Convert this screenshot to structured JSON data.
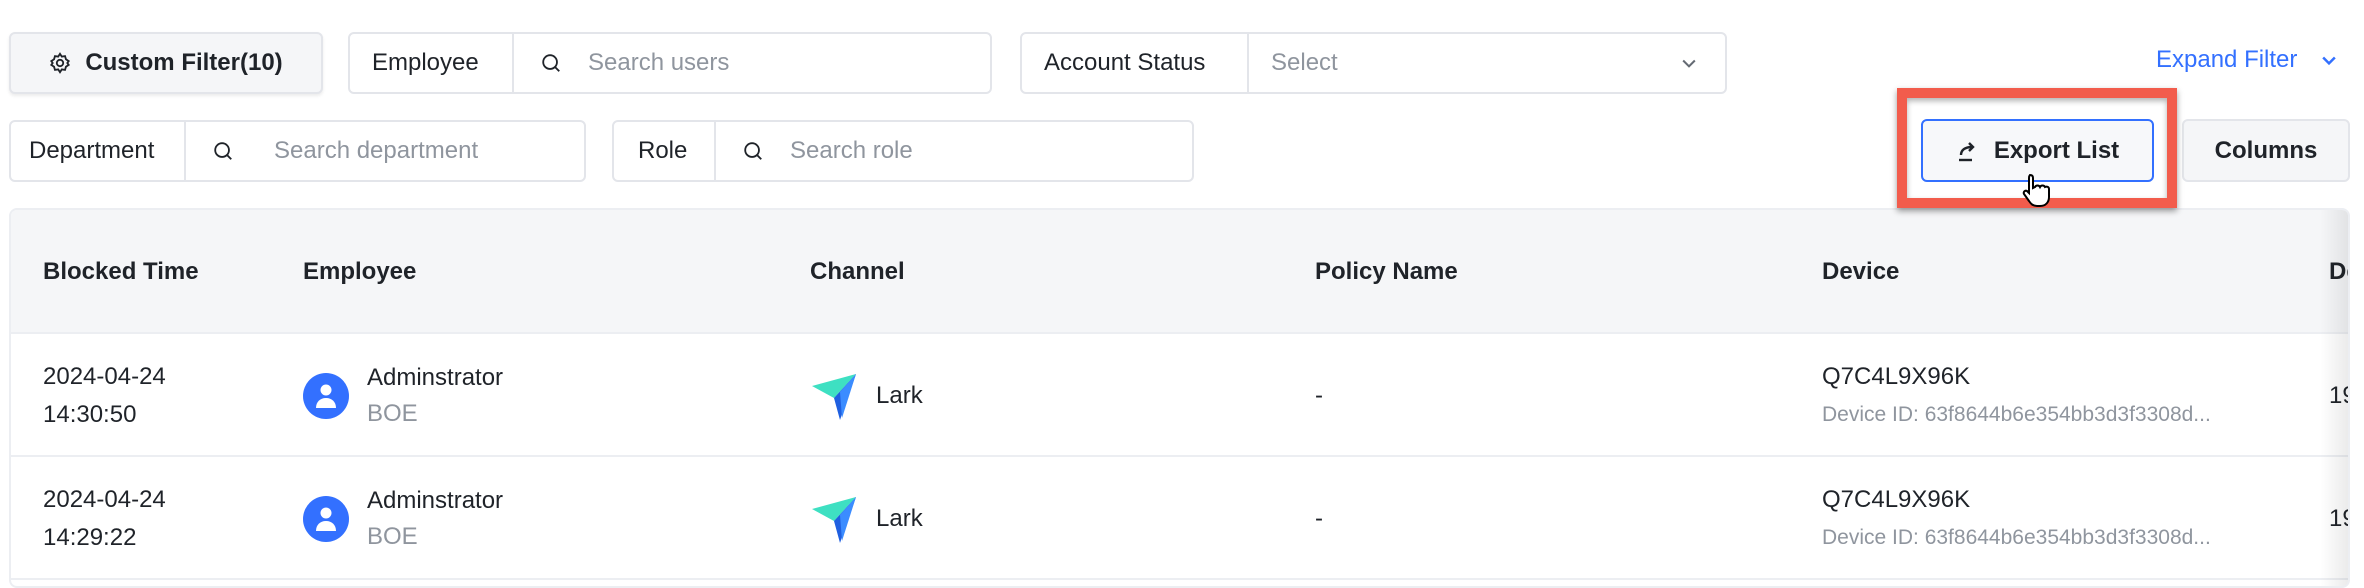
{
  "filters": {
    "custom_filter_label": "Custom Filter(10)",
    "employee": {
      "label": "Employee",
      "placeholder": "Search users"
    },
    "account_status": {
      "label": "Account Status",
      "placeholder": "Select"
    },
    "expand_filter_label": "Expand Filter",
    "department": {
      "label": "Department",
      "placeholder": "Search department"
    },
    "role": {
      "label": "Role",
      "placeholder": "Search role"
    }
  },
  "toolbar": {
    "export_label": "Export List",
    "columns_label": "Columns"
  },
  "colors": {
    "accent": "#3370ff",
    "highlight": "#f25c4c"
  },
  "table": {
    "columns": [
      "Blocked Time",
      "Employee",
      "Channel",
      "Policy Name",
      "Device",
      "De"
    ],
    "rows": [
      {
        "date": "2024-04-24",
        "time": "14:30:50",
        "employee": "Adminstrator",
        "dept": "BOE",
        "channel": "Lark",
        "policy": "-",
        "device": "Q7C4L9X96K",
        "device_id": "Device ID: 63f8644b6e354bb3d3f3308d...",
        "extra": "19"
      },
      {
        "date": "2024-04-24",
        "time": "14:29:22",
        "employee": "Adminstrator",
        "dept": "BOE",
        "channel": "Lark",
        "policy": "-",
        "device": "Q7C4L9X96K",
        "device_id": "Device ID: 63f8644b6e354bb3d3f3308d...",
        "extra": "19"
      }
    ]
  }
}
